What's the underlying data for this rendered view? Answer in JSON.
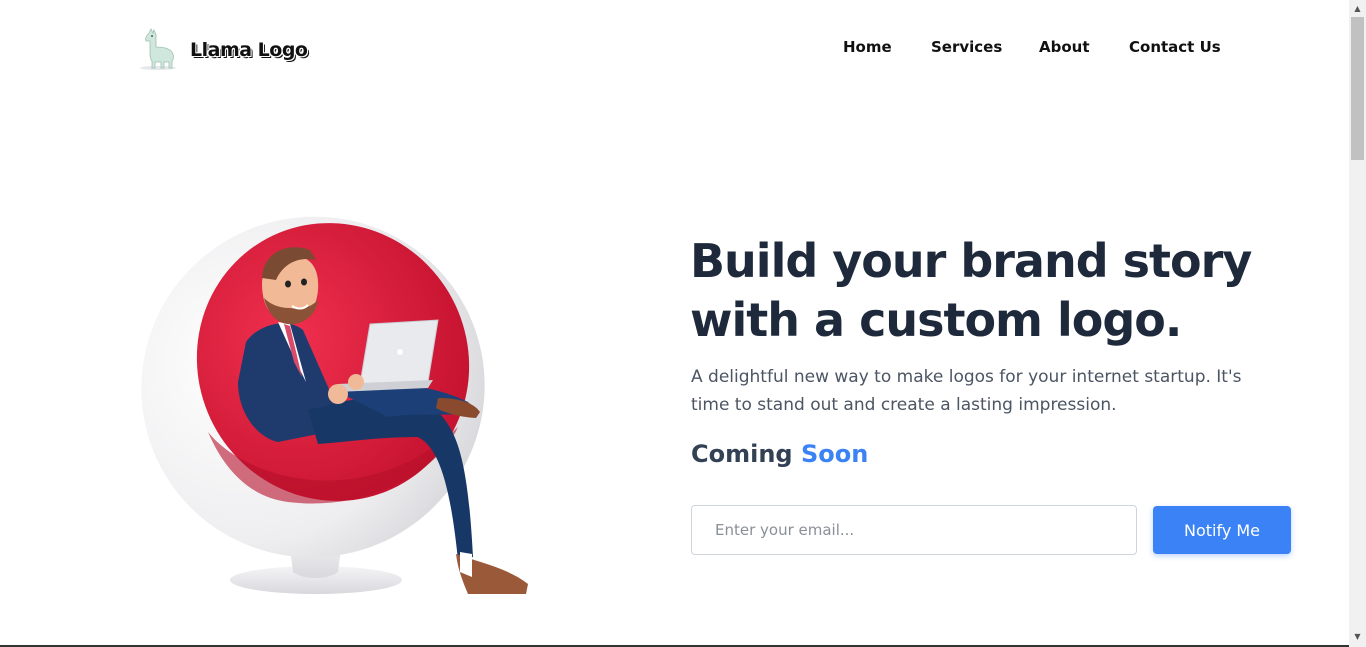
{
  "header": {
    "logo_text": "Llama Logo",
    "nav": [
      "Home",
      "Services",
      "About",
      "Contact Us"
    ]
  },
  "hero": {
    "title_line1": "Build your brand story",
    "title_line2": "with a custom logo.",
    "description_line1": "A delightful new way to make logos for your internet startup. It's",
    "description_line2": "time to stand out and create a lasting impression.",
    "coming": "Coming",
    "soon": "Soon",
    "email_placeholder": "Enter your email...",
    "notify_label": "Notify Me"
  },
  "colors": {
    "accent": "#3b82f6",
    "heading": "#1e293b",
    "chair_red": "#e3183b"
  },
  "icons": {
    "logo": "llama-icon",
    "scroll_up": "chevron-up-icon",
    "scroll_down": "chevron-down-icon"
  }
}
